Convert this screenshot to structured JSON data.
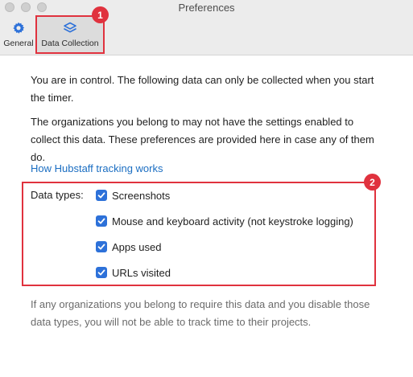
{
  "window": {
    "title": "Preferences"
  },
  "toolbar": {
    "items": [
      {
        "label": "General",
        "icon": "gear-icon"
      },
      {
        "label": "Data Collection",
        "icon": "layers-icon",
        "selected": true
      }
    ]
  },
  "annotations": [
    "1",
    "2"
  ],
  "content": {
    "intro": "You are in control. The following data can only be collected when you start the timer.",
    "orgs_note": "The organizations you belong to may not have the settings enabled to collect this data. These preferences are provided here in case any of them do.",
    "link": "How Hubstaff tracking works",
    "data_types_label": "Data types:",
    "data_types": [
      {
        "label": "Screenshots",
        "checked": true
      },
      {
        "label": "Mouse and keyboard activity (not keystroke logging)",
        "checked": true
      },
      {
        "label": "Apps used",
        "checked": true
      },
      {
        "label": "URLs visited",
        "checked": true
      }
    ],
    "footer_note": "If any organizations you belong to require this data and you disable those data types, you will not be able to track time to their projects."
  },
  "colors": {
    "accent": "#2d71d9",
    "link": "#1b6ec2",
    "highlight": "#e0323e"
  }
}
